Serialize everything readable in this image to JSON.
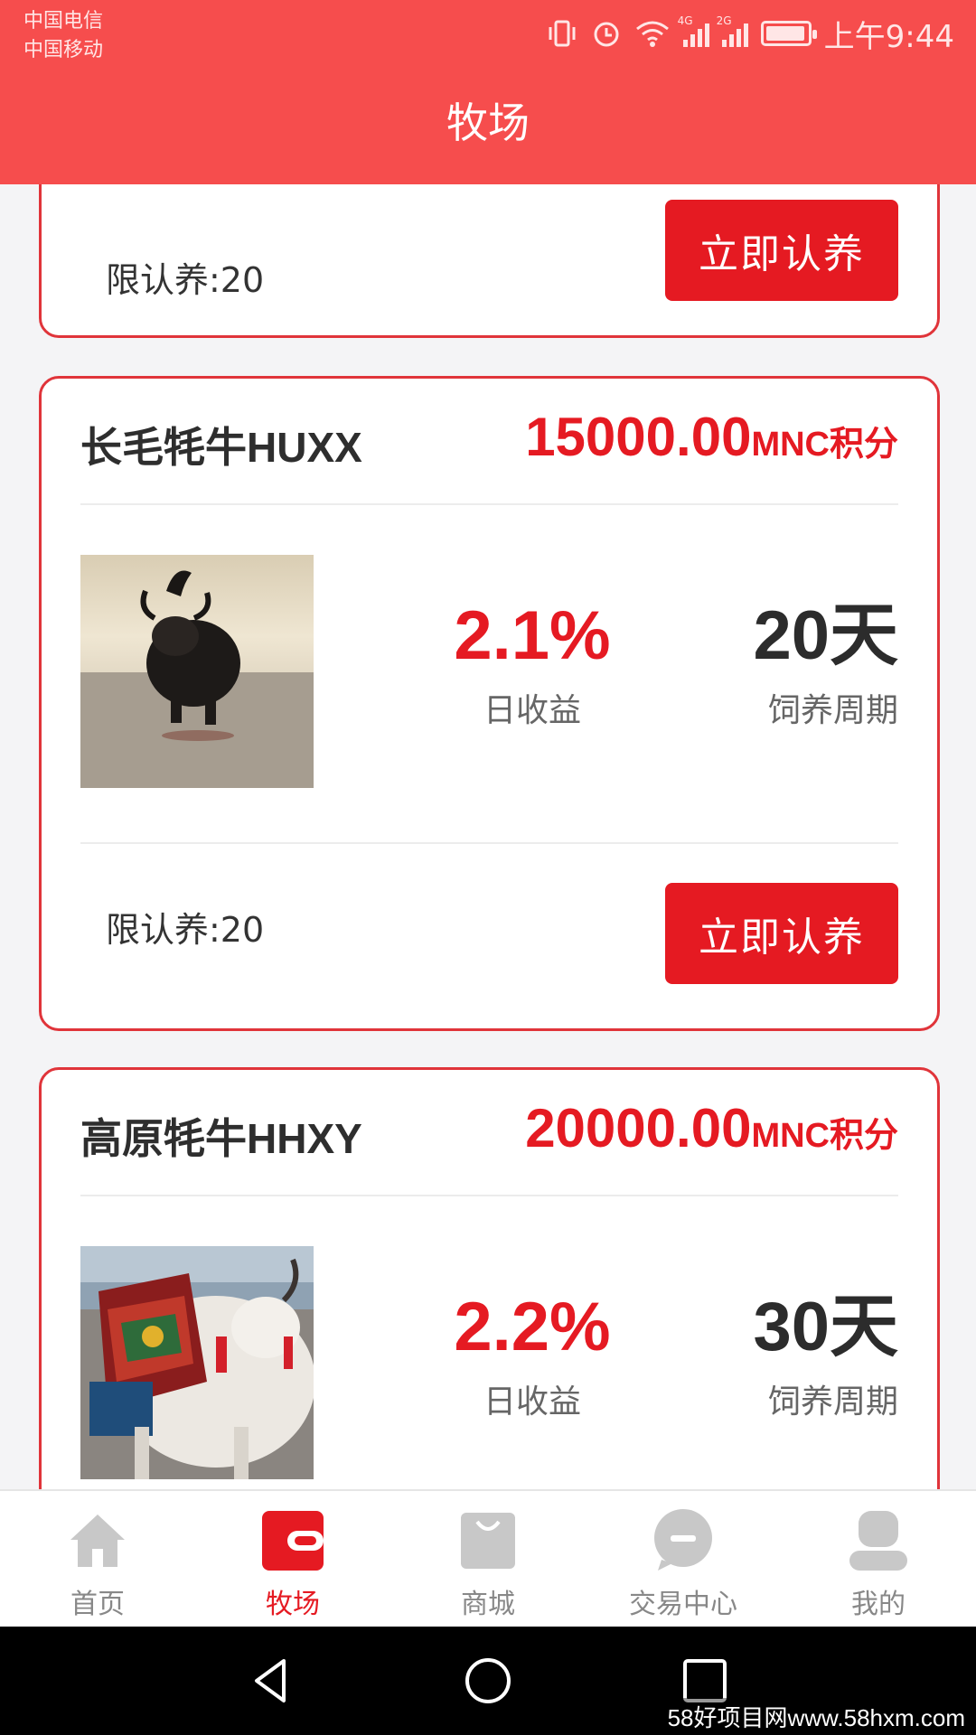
{
  "status_bar": {
    "carrier_1": "中国电信",
    "carrier_2": "中国移动",
    "signal_1_tag": "4G",
    "signal_2_tag": "2G",
    "time": "上午9:44"
  },
  "header": {
    "title": "牧场"
  },
  "top_card": {
    "limit_label": "限认养:20",
    "button_label": "立即认养"
  },
  "products": [
    {
      "name": "长毛牦牛HUXX",
      "price": "15000.00",
      "price_unit": "MNC积分",
      "daily_yield": "2.1%",
      "daily_yield_label": "日收益",
      "period": "20天",
      "period_label": "饲养周期",
      "limit_label": "限认养:20",
      "button_label": "立即认养"
    },
    {
      "name": "高原牦牛HHXY",
      "price": "20000.00",
      "price_unit": "MNC积分",
      "daily_yield": "2.2%",
      "daily_yield_label": "日收益",
      "period": "30天",
      "period_label": "饲养周期"
    }
  ],
  "tabs": [
    {
      "label": "首页",
      "icon": "home-icon"
    },
    {
      "label": "牧场",
      "icon": "wallet-icon",
      "active": true
    },
    {
      "label": "商城",
      "icon": "shopping-bag-icon"
    },
    {
      "label": "交易中心",
      "icon": "chat-bubble-icon"
    },
    {
      "label": "我的",
      "icon": "user-icon"
    }
  ],
  "colors": {
    "brand_red": "#e51a22",
    "header_red": "#f64d4d"
  },
  "watermark": "58好项目网www.58hxm.com"
}
